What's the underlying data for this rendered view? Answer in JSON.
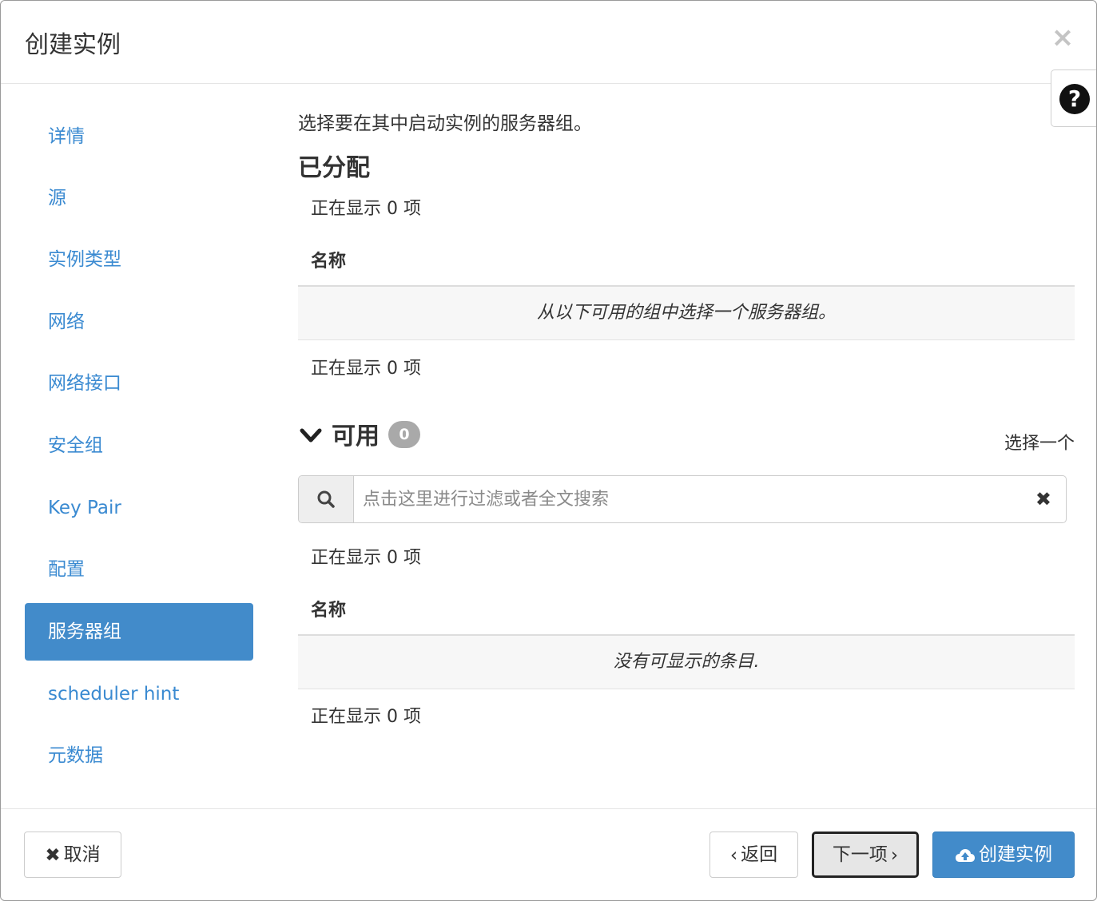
{
  "header": {
    "title": "创建实例",
    "close_icon": "×"
  },
  "help": {
    "icon": "?"
  },
  "nav": {
    "items": [
      {
        "label": "详情"
      },
      {
        "label": "源"
      },
      {
        "label": "实例类型"
      },
      {
        "label": "网络"
      },
      {
        "label": "网络接口"
      },
      {
        "label": "安全组"
      },
      {
        "label": "Key Pair"
      },
      {
        "label": "配置"
      },
      {
        "label": "服务器组",
        "active": true
      },
      {
        "label": "scheduler hint"
      },
      {
        "label": "元数据"
      }
    ]
  },
  "content": {
    "intro": "选择要在其中启动实例的服务器组。",
    "allocated": {
      "title": "已分配",
      "count_top": "正在显示 0 项",
      "column_name": "名称",
      "empty_message": "从以下可用的组中选择一个服务器组。",
      "count_bottom": "正在显示 0 项"
    },
    "available": {
      "title": "可用",
      "badge": "0",
      "select_one": "选择一个",
      "search_placeholder": "点击这里进行过滤或者全文搜索",
      "clear_icon": "✖",
      "count_top": "正在显示 0 项",
      "column_name": "名称",
      "empty_message": "没有可显示的条目.",
      "count_bottom": "正在显示 0 项"
    }
  },
  "footer": {
    "cancel_icon": "✖",
    "cancel_label": "取消",
    "back_icon": "‹",
    "back_label": "返回",
    "next_label": "下一项",
    "next_icon": "›",
    "create_label": "创建实例"
  },
  "colors": {
    "primary": "#428bca",
    "link": "#3a8ad1",
    "badge": "#a9a9a9"
  }
}
